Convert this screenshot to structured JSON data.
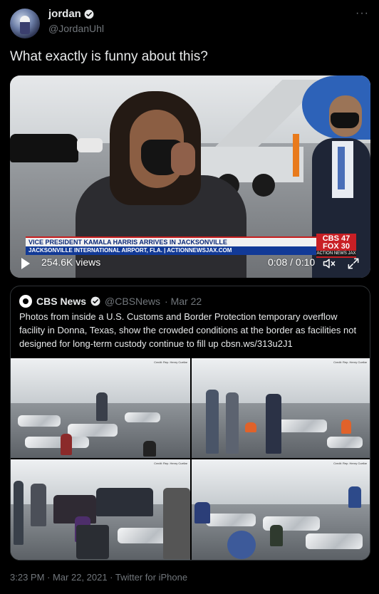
{
  "author": {
    "name": "jordan",
    "handle": "@JordanUhl",
    "avatar_icon": "avatar-icon",
    "verified_icon": "verified-badge-icon"
  },
  "tweet": {
    "text": "What exactly is funny about this?",
    "more_icon": "more-options-icon",
    "more_label": "···"
  },
  "video": {
    "chyron_top": "VICE PRESIDENT KAMALA HARRIS ARRIVES IN JACKSONVILLE",
    "chyron_bottom": "JACKSONVILLE INTERNATIONAL AIRPORT, FLA. | ACTIONNEWSJAX.COM",
    "station_logo_top": "CBS 47",
    "station_logo_bottom": "FOX 30",
    "station_logo_sub": "ACTION NEWS JAX",
    "views": "254.6K views",
    "time": "0:08 / 0:10",
    "play_icon": "play-icon",
    "volume_icon": "volume-icon",
    "fullscreen_icon": "fullscreen-icon"
  },
  "quote": {
    "name": "CBS News",
    "handle": "@CBSNews",
    "date": "· Mar 22",
    "text": "Photos from inside a U.S. Customs and Border Protection temporary overflow facility in Donna, Texas, show the crowded conditions at the border as facilities not designed for long-term custody continue to fill up cbsn.ws/313u2J1",
    "photo_credit": "Credit: Rep. Henry Cuellar"
  },
  "footer": {
    "timestamp": "3:23 PM · Mar 22, 2021 · Twitter for iPhone"
  }
}
